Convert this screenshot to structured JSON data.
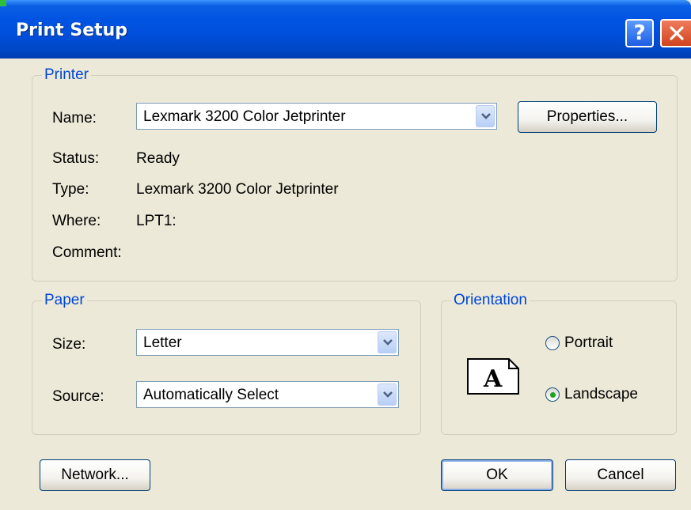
{
  "dialog": {
    "title": "Print Setup",
    "help_label": "?"
  },
  "printer": {
    "legend": "Printer",
    "name_label": "Name:",
    "name_value": "Lexmark 3200 Color Jetprinter",
    "properties_label": "Properties...",
    "status_label": "Status:",
    "status_value": "Ready",
    "type_label": "Type:",
    "type_value": "Lexmark 3200 Color Jetprinter",
    "where_label": "Where:",
    "where_value": "LPT1:",
    "comment_label": "Comment:",
    "comment_value": ""
  },
  "paper": {
    "legend": "Paper",
    "size_label": "Size:",
    "size_value": "Letter",
    "source_label": "Source:",
    "source_value": "Automatically Select"
  },
  "orientation": {
    "legend": "Orientation",
    "icon_letter": "A",
    "portrait_label": "Portrait",
    "landscape_label": "Landscape",
    "selected": "Landscape"
  },
  "buttons": {
    "network_label": "Network...",
    "ok_label": "OK",
    "cancel_label": "Cancel"
  },
  "colors": {
    "title_bar": "#0053e1",
    "group_legend": "#0046d5",
    "dialog_bg": "#ece9d8",
    "close_button": "#d1431f",
    "radio_checked": "#21a121"
  }
}
